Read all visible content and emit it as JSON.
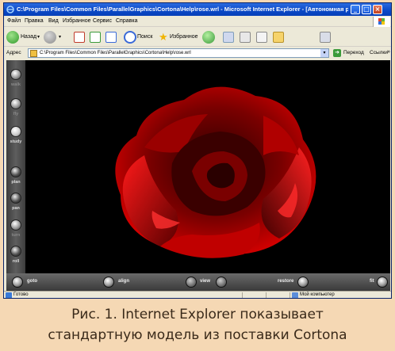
{
  "window": {
    "title": "C:\\Program Files\\Common Files\\ParallelGraphics\\Cortona\\Help\\rose.wrl - Microsoft Internet Explorer - [Автономная работа]",
    "min_glyph": "_",
    "max_glyph": "□",
    "close_glyph": "×"
  },
  "menu": {
    "items": [
      "Файл",
      "Правка",
      "Вид",
      "Избранное",
      "Сервис",
      "Справка"
    ]
  },
  "toolbar": {
    "back_label": "Назад",
    "search_label": "Поиск",
    "favorites_label": "Избранное"
  },
  "address": {
    "label": "Адрес",
    "url": "C:\\Program Files\\Common Files\\ParallelGraphics\\Cortona\\Help\\rose.wrl",
    "go_label": "Переход",
    "links_label": "Ссылки",
    "links_chevron": "»"
  },
  "cortona": {
    "side_buttons": [
      "walk",
      "fly",
      "study",
      "plan",
      "pan",
      "turn",
      "roll"
    ],
    "bottom": {
      "goto": "goto",
      "align": "align",
      "view": "view",
      "restore": "restore",
      "fit": "fit"
    }
  },
  "status": {
    "ready": "Готово",
    "zone": "Мой компьютер"
  },
  "caption": {
    "line1": "Рис. 1. Internet Explorer показывает",
    "line2": "стандартную модель из поставки Cortona"
  },
  "colors": {
    "caption_bg": "#f5d8b4",
    "rose_red": "#e00000",
    "titlebar_blue": "#0a48c6"
  }
}
